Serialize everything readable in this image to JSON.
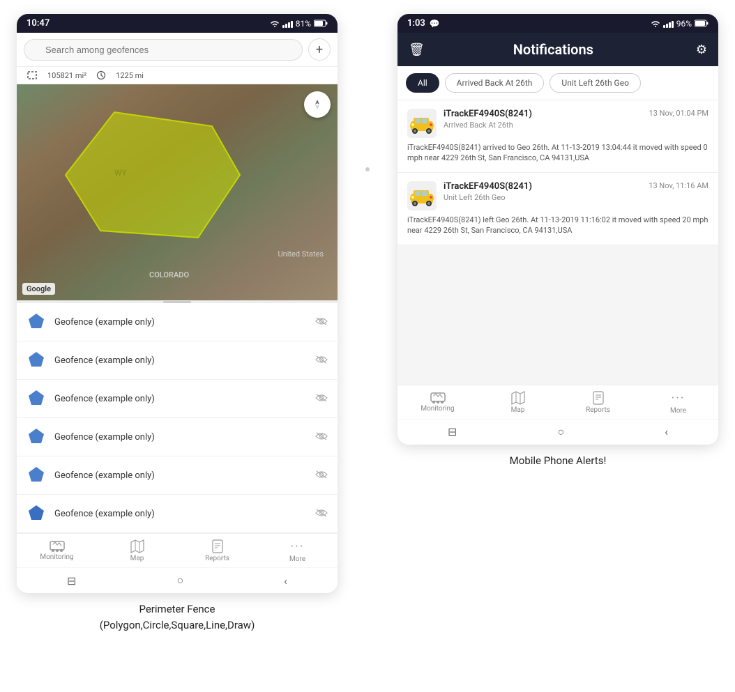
{
  "left_phone": {
    "status_bar": {
      "time": "10:47",
      "wifi": "WiFi",
      "signal": "4G",
      "battery": "81%"
    },
    "search": {
      "placeholder": "Search among geofences"
    },
    "stats": {
      "area": "105821 mi²",
      "distance": "1225 mi"
    },
    "map": {
      "region_wy": "WY",
      "region_co": "COLORADO",
      "region_us": "United States",
      "google_label": "Google"
    },
    "geofence_items": [
      {
        "label": "Geofence (example only)"
      },
      {
        "label": "Geofence (example only)"
      },
      {
        "label": "Geofence (example only)"
      },
      {
        "label": "Geofence (example only)"
      },
      {
        "label": "Geofence (example only)"
      },
      {
        "label": "Geofence (example only)"
      }
    ],
    "bottom_nav": [
      {
        "icon": "🚌",
        "label": "Monitoring"
      },
      {
        "icon": "🗺",
        "label": "Map"
      },
      {
        "icon": "📊",
        "label": "Reports"
      },
      {
        "icon": "···",
        "label": "More"
      }
    ],
    "caption": "Perimeter Fence\n(Polygon,Circle,Square,Line,Draw)"
  },
  "right_phone": {
    "status_bar": {
      "time": "1:03",
      "chat": "💬",
      "wifi": "WiFi",
      "signal": "4G",
      "battery": "96%"
    },
    "header": {
      "title": "Notifications",
      "delete_icon": "🗑",
      "settings_icon": "⚙"
    },
    "filters": [
      {
        "label": "All",
        "active": true
      },
      {
        "label": "Arrived Back At 26th",
        "active": false
      },
      {
        "label": "Unit Left 26th Geo",
        "active": false
      }
    ],
    "notifications": [
      {
        "device": "iTrackEF4940S(8241)",
        "time": "13 Nov, 01:04 PM",
        "subtitle": "Arrived Back At 26th",
        "body": "iTrackEF4940S(8241) arrived to Geo 26th.   At 11-13-2019 13:04:44 it moved with speed 0 mph near 4229 26th St, San Francisco, CA 94131,USA"
      },
      {
        "device": "iTrackEF4940S(8241)",
        "time": "13 Nov, 11:16 AM",
        "subtitle": "Unit Left 26th Geo",
        "body": "iTrackEF4940S(8241) left Geo  26th.   At 11-13-2019 11:16:02 it moved with speed 20 mph near 4229 26th St, San Francisco, CA 94131,USA"
      }
    ],
    "bottom_nav": [
      {
        "icon": "🚌",
        "label": "Monitoring"
      },
      {
        "icon": "🗺",
        "label": "Map"
      },
      {
        "icon": "📊",
        "label": "Reports"
      },
      {
        "icon": "···",
        "label": "More"
      }
    ],
    "caption": "Mobile Phone Alerts!"
  }
}
